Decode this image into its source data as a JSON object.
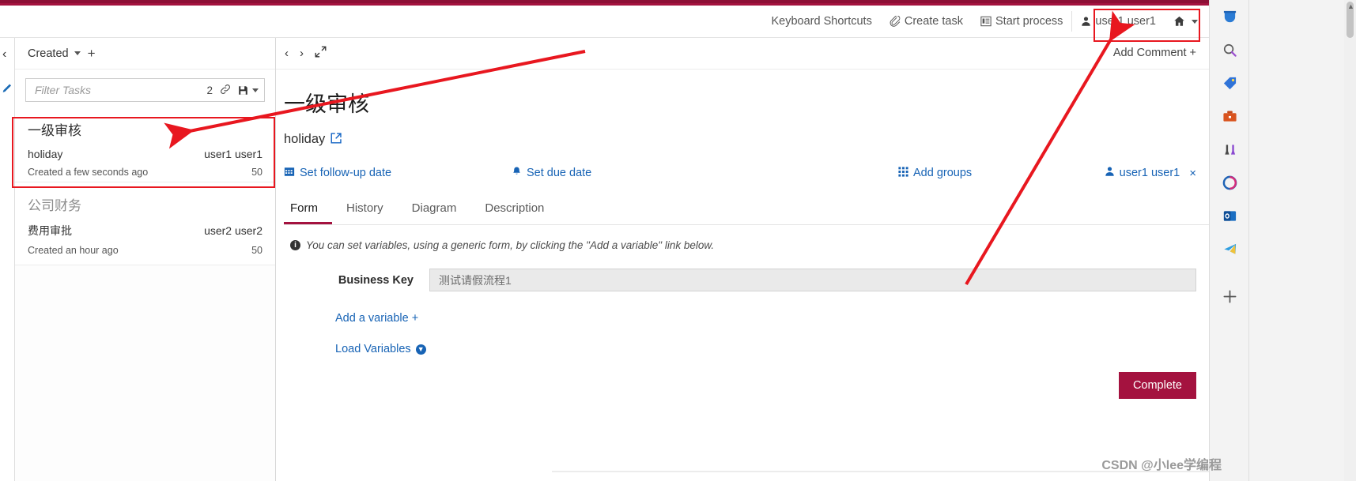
{
  "theme": {
    "brand_red": "#a4123f",
    "link_blue": "#1763b5",
    "annotation_red": "#e8171f"
  },
  "header": {
    "items": [
      {
        "label": "Keyboard Shortcuts",
        "icon": ""
      },
      {
        "label": "Create task",
        "icon": "paperclip-icon"
      },
      {
        "label": "Start process",
        "icon": "list-icon"
      },
      {
        "label": "user1 user1",
        "icon": "user-icon"
      }
    ],
    "home_icon": "home-icon"
  },
  "left_rail": {
    "collapse_icon": "chevron-left-icon",
    "edit_icon": "pencil-icon"
  },
  "task_list": {
    "sort_label": "Created",
    "add_label": "+",
    "filter": {
      "placeholder": "Filter Tasks",
      "count": "2",
      "link_icon": "link-icon",
      "save_icon": "save-icon"
    },
    "tasks": [
      {
        "title": "一级审核",
        "process": "holiday",
        "assignee": "user1 user1",
        "created": "Created a few seconds ago",
        "priority": "50",
        "selected": true
      },
      {
        "title": "公司财务",
        "process": "费用审批",
        "assignee": "user2 user2",
        "created": "Created an hour ago",
        "priority": "50",
        "selected": false
      }
    ]
  },
  "main": {
    "nav": {
      "back_icon": "chevron-left-icon",
      "forward_icon": "chevron-right-icon",
      "expand_icon": "expand-icon",
      "add_comment": "Add Comment +"
    },
    "title": "一级审核",
    "process_name": "holiday",
    "process_link_icon": "external-link-icon",
    "actions": [
      {
        "label": "Set follow-up date",
        "icon": "calendar-icon"
      },
      {
        "label": "Set due date",
        "icon": "bell-icon"
      },
      {
        "label": "Add groups",
        "icon": "grid-icon"
      },
      {
        "label": "user1 user1",
        "icon": "user-icon",
        "remove": "×"
      }
    ],
    "tabs": [
      {
        "label": "Form",
        "active": true
      },
      {
        "label": "History",
        "active": false
      },
      {
        "label": "Diagram",
        "active": false
      },
      {
        "label": "Description",
        "active": false
      }
    ],
    "info_message": "You can set variables, using a generic form, by clicking the \"Add a variable\" link below.",
    "info_icon": "info-icon",
    "form": {
      "business_key_label": "Business Key",
      "business_key_value": "测试请假流程1",
      "add_variable": "Add a variable +",
      "load_variables": "Load Variables"
    },
    "complete_button": "Complete"
  },
  "edge_rail": {
    "icons": [
      "drop-icon",
      "search-icon",
      "tag-icon",
      "briefcase-icon",
      "games-icon",
      "microsoft365-icon",
      "outlook-icon",
      "send-icon",
      "add-icon"
    ]
  },
  "watermark": "CSDN @小lee学编程"
}
